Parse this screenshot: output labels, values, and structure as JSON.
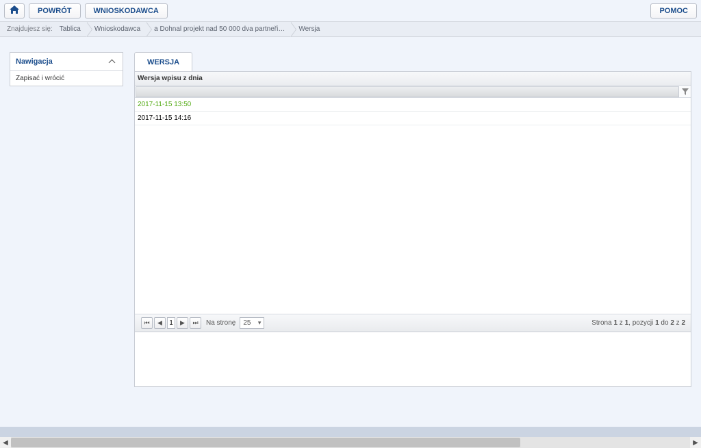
{
  "topbar": {
    "back": "POWRÓT",
    "applicant": "WNIOSKODAWCA",
    "help": "POMOC"
  },
  "breadcrumb": {
    "label": "Znajdujesz się:",
    "items": [
      "Tablica",
      "Wnioskodawca",
      "a Dohnal projekt nad 50 000 dva partneři…",
      "Wersja"
    ]
  },
  "sidebar": {
    "header": "Nawigacja",
    "items": [
      "Zapisać i wrócić"
    ]
  },
  "tab": {
    "label": "WERSJA"
  },
  "grid": {
    "header": "Wersja wpisu z dnia",
    "rows": [
      "2017-11-15 13:50",
      "2017-11-15 14:16"
    ]
  },
  "pager": {
    "page": "1",
    "perPageLabel": "Na stronę",
    "perPage": "25",
    "info_prefix": "Strona ",
    "info_page": "1",
    "info_of": " z ",
    "info_pages": "1",
    "info_pos": ", pozycji ",
    "info_from": "1",
    "info_to_label": " do ",
    "info_to": "2",
    "info_total_label": " z ",
    "info_total": "2"
  }
}
